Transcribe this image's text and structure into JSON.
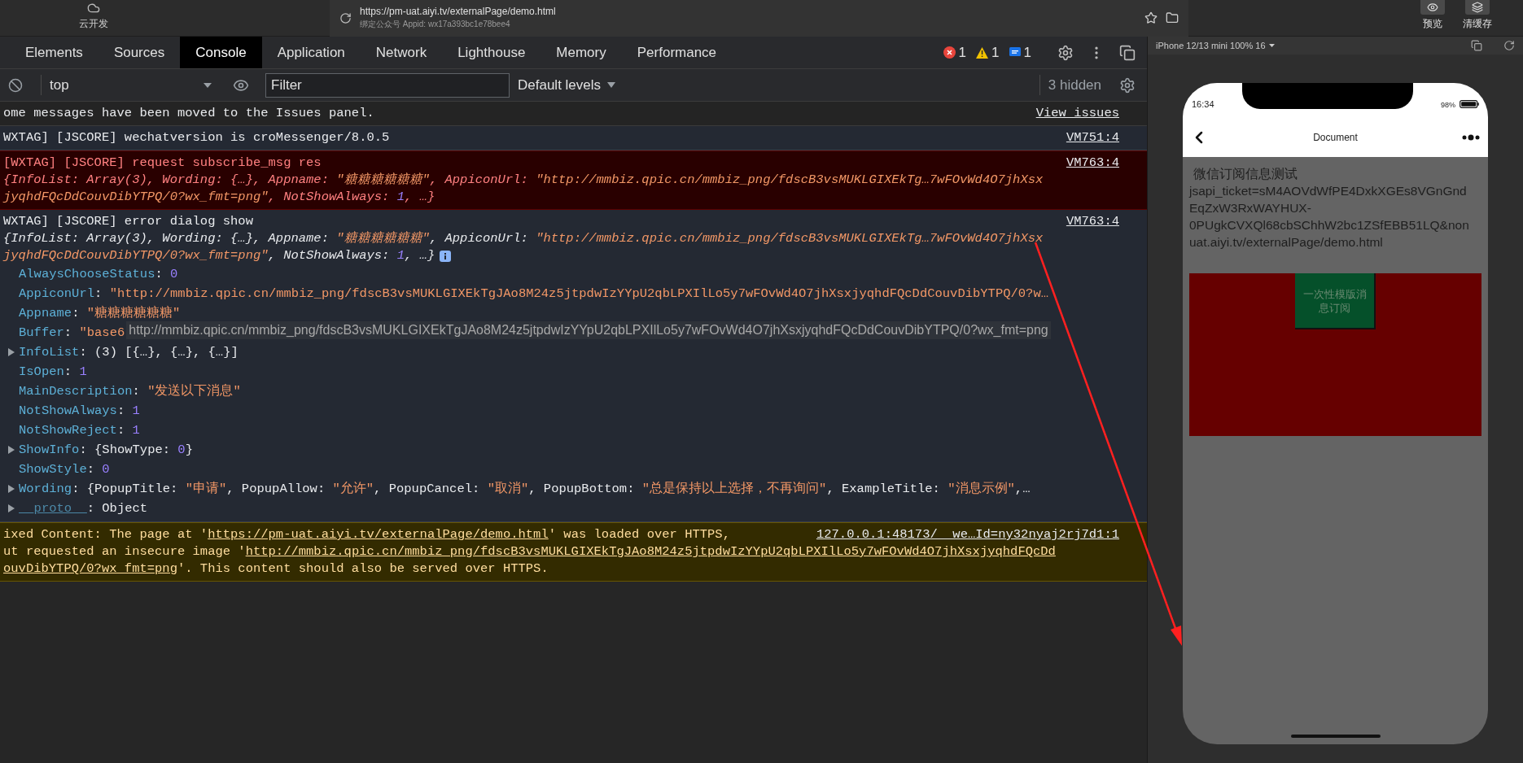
{
  "top_bar": {
    "cloud_label": "云开发",
    "url": "https://pm-uat.aiyi.tv/externalPage/demo.html",
    "appid": "绑定公众号 Appid: wx17a393bc1e78bee4",
    "buttons": [
      {
        "kind": "preview",
        "label": "预览"
      },
      {
        "kind": "clear-cache",
        "label": "清缓存"
      }
    ]
  },
  "devtools": {
    "tabs": [
      {
        "label": "Elements",
        "selected": false
      },
      {
        "label": "Sources",
        "selected": false
      },
      {
        "label": "Console",
        "selected": true
      },
      {
        "label": "Application",
        "selected": false
      },
      {
        "label": "Network",
        "selected": false
      },
      {
        "label": "Lighthouse",
        "selected": false
      },
      {
        "label": "Memory",
        "selected": false
      },
      {
        "label": "Performance",
        "selected": false
      }
    ],
    "counts": {
      "errors": "1",
      "warnings": "1",
      "info": "1"
    },
    "toolbar": {
      "context": "top",
      "filter_placeholder": "Filter",
      "levels": "Default levels",
      "hidden": "3 hidden"
    },
    "messages": [
      {
        "kind": "notice",
        "source": "View issues",
        "lines": [
          {
            "kind": "header",
            "segments": [
              {
                "kind": "text",
                "text": "ome messages have been moved to the Issues panel."
              }
            ]
          }
        ]
      },
      {
        "kind": "log",
        "source": "VM751:4",
        "lines": [
          {
            "kind": "header",
            "segments": [
              {
                "kind": "text",
                "text": "WXTAG] [JSCORE] wechatversion is croMessenger/8.0.5"
              }
            ]
          }
        ]
      },
      {
        "kind": "error",
        "source": "VM763:4",
        "lines": [
          {
            "kind": "header",
            "segments": [
              {
                "kind": "text",
                "text": "[WXTAG] [JSCORE] request subscribe_msg res"
              }
            ]
          },
          {
            "kind": "preview",
            "segments": [
              {
                "kind": "text",
                "text": "{InfoList: Array(3), Wording: {…}, Appname: "
              },
              {
                "kind": "str",
                "text": "\"糖糖糖糖糖糖\""
              },
              {
                "kind": "text",
                "text": ", AppiconUrl: "
              },
              {
                "kind": "str",
                "text": "\"http://mmbiz.qpic.cn/mmbiz_png/fdscB3vsMUKLGIXEkTg…7wFOvWd4O7jhXsx"
              }
            ]
          },
          {
            "kind": "preview",
            "segments": [
              {
                "kind": "str",
                "text": "jyqhdFQcDdCouvDibYTPQ/0?wx_fmt=png\""
              },
              {
                "kind": "text",
                "text": ", NotShowAlways: "
              },
              {
                "kind": "num",
                "text": "1"
              },
              {
                "kind": "text",
                "text": ", …}"
              }
            ]
          }
        ]
      },
      {
        "kind": "log",
        "source": "VM763:4",
        "badge": true,
        "lines": [
          {
            "kind": "header",
            "segments": [
              {
                "kind": "text",
                "text": "WXTAG] [JSCORE] error dialog show"
              }
            ]
          },
          {
            "kind": "preview",
            "segments": [
              {
                "kind": "text",
                "text": "{InfoList: Array(3), Wording: {…}, Appname: "
              },
              {
                "kind": "str",
                "text": "\"糖糖糖糖糖糖\""
              },
              {
                "kind": "text",
                "text": ", AppiconUrl: "
              },
              {
                "kind": "str",
                "text": "\"http://mmbiz.qpic.cn/mmbiz_png/fdscB3vsMUKLGIXEkTg…7wFOvWd4O7jhXsx"
              }
            ]
          },
          {
            "kind": "preview",
            "segments": [
              {
                "kind": "str",
                "text": "jyqhdFQcDdCouvDibYTPQ/0?wx_fmt=png\""
              },
              {
                "kind": "text",
                "text": ", NotShowAlways: "
              },
              {
                "kind": "num",
                "text": "1"
              },
              {
                "kind": "text",
                "text": ", …}"
              }
            ]
          }
        ],
        "properties": [
          {
            "expandable": false,
            "segments": [
              {
                "kind": "key",
                "text": "AlwaysChooseStatus"
              },
              {
                "kind": "text",
                "text": ": "
              },
              {
                "kind": "num",
                "text": "0"
              }
            ]
          },
          {
            "expandable": false,
            "segments": [
              {
                "kind": "key",
                "text": "AppiconUrl"
              },
              {
                "kind": "text",
                "text": ": "
              },
              {
                "kind": "str",
                "text": "\"http://mmbiz.qpic.cn/mmbiz_png/fdscB3vsMUKLGIXEkTgJAo8M24z5jtpdwIzYYpU2qbLPXIlLo5y7wFOvWd4O7jhXsxjyqhdFQcDdCouvDibYTPQ/0?w…"
              }
            ]
          },
          {
            "expandable": false,
            "segments": [
              {
                "kind": "key",
                "text": "Appname"
              },
              {
                "kind": "text",
                "text": ": "
              },
              {
                "kind": "str",
                "text": "\"糖糖糖糖糖糖\""
              }
            ]
          },
          {
            "expandable": false,
            "segments": [
              {
                "kind": "key",
                "text": "Buffer"
              },
              {
                "kind": "text",
                "text": ": "
              },
              {
                "kind": "str",
                "text": "\"base6"
              }
            ],
            "tooltip": "http://mmbiz.qpic.cn/mmbiz_png/fdscB3vsMUKLGIXEkTgJAo8M24z5jtpdwIzYYpU2qbLPXIlLo5y7wFOvWd4O7jhXsxjyqhdFQcDdCouvDibYTPQ/0?wx_fmt=png"
          },
          {
            "expandable": true,
            "segments": [
              {
                "kind": "key",
                "text": "InfoList"
              },
              {
                "kind": "text",
                "text": ": (3) [{…}, {…}, {…}]"
              }
            ]
          },
          {
            "expandable": false,
            "segments": [
              {
                "kind": "key",
                "text": "IsOpen"
              },
              {
                "kind": "text",
                "text": ": "
              },
              {
                "kind": "num",
                "text": "1"
              }
            ]
          },
          {
            "expandable": false,
            "segments": [
              {
                "kind": "key",
                "text": "MainDescription"
              },
              {
                "kind": "text",
                "text": ": "
              },
              {
                "kind": "str",
                "text": "\"发送以下消息\""
              }
            ]
          },
          {
            "expandable": false,
            "segments": [
              {
                "kind": "key",
                "text": "NotShowAlways"
              },
              {
                "kind": "text",
                "text": ": "
              },
              {
                "kind": "num",
                "text": "1"
              }
            ]
          },
          {
            "expandable": false,
            "segments": [
              {
                "kind": "key",
                "text": "NotShowReject"
              },
              {
                "kind": "text",
                "text": ": "
              },
              {
                "kind": "num",
                "text": "1"
              }
            ]
          },
          {
            "expandable": true,
            "segments": [
              {
                "kind": "key",
                "text": "ShowInfo"
              },
              {
                "kind": "text",
                "text": ": {ShowType: "
              },
              {
                "kind": "num",
                "text": "0"
              },
              {
                "kind": "text",
                "text": "}"
              }
            ]
          },
          {
            "expandable": false,
            "segments": [
              {
                "kind": "key",
                "text": "ShowStyle"
              },
              {
                "kind": "text",
                "text": ": "
              },
              {
                "kind": "num",
                "text": "0"
              }
            ]
          },
          {
            "expandable": true,
            "segments": [
              {
                "kind": "key",
                "text": "Wording"
              },
              {
                "kind": "text",
                "text": ": {PopupTitle: "
              },
              {
                "kind": "str",
                "text": "\"申请\""
              },
              {
                "kind": "text",
                "text": ", PopupAllow: "
              },
              {
                "kind": "str",
                "text": "\"允许\""
              },
              {
                "kind": "text",
                "text": ", PopupCancel: "
              },
              {
                "kind": "str",
                "text": "\"取消\""
              },
              {
                "kind": "text",
                "text": ", PopupBottom: "
              },
              {
                "kind": "str",
                "text": "\"总是保持以上选择，不再询问\""
              },
              {
                "kind": "text",
                "text": ", ExampleTitle: "
              },
              {
                "kind": "str",
                "text": "\"消息示例\""
              },
              {
                "kind": "text",
                "text": ",…"
              }
            ]
          },
          {
            "expandable": true,
            "segments": [
              {
                "kind": "proto",
                "text": "__proto__"
              },
              {
                "kind": "text",
                "text": ": Object"
              }
            ]
          }
        ]
      },
      {
        "kind": "warning",
        "source": "127.0.0.1:48173/__we…Id=ny32nyaj2rj7d1:1",
        "lines": [
          {
            "kind": "header",
            "segments": [
              {
                "kind": "text",
                "text": "ixed Content: The page at '"
              },
              {
                "kind": "link",
                "text": "https://pm-uat.aiyi.tv/externalPage/demo.html"
              },
              {
                "kind": "text",
                "text": "' was loaded over HTTPS,"
              }
            ]
          },
          {
            "kind": "header",
            "segments": [
              {
                "kind": "text",
                "text": "ut requested an insecure image '"
              },
              {
                "kind": "link",
                "text": "http://mmbiz.qpic.cn/mmbiz_png/fdscB3vsMUKLGIXEkTgJAo8M24z5jtpdwIzYYpU2qbLPXIlLo5y7wFOvWd4O7jhXsxjyqhdFQcDd"
              }
            ]
          },
          {
            "kind": "header",
            "segments": [
              {
                "kind": "link",
                "text": "ouvDibYTPQ/0?wx_fmt=png"
              },
              {
                "kind": "text",
                "text": "'. This content should also be served over HTTPS."
              }
            ]
          }
        ]
      }
    ]
  },
  "simulator": {
    "device": "iPhone 12/13 mini 100% 16",
    "time": "16:34",
    "battery": "98%",
    "nav_title": "Document",
    "heading": "微信订阅信息测试",
    "lines": [
      "jsapi_ticket=sM4AOVdWfPE4DxkXGEs8VGnGnd",
      "EqZxW3RxWAYHUX-",
      "0PUgkCVXQl68cbSChhW2bc1ZSfEBB51LQ&non",
      "uat.aiyi.tv/externalPage/demo.html"
    ],
    "button": "一次性模版消息订阅"
  }
}
